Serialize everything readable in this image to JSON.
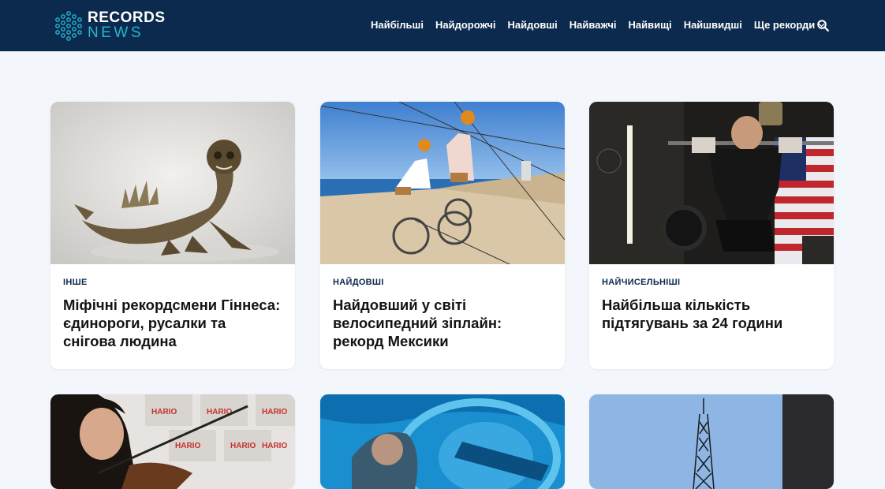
{
  "logo": {
    "top": "RECORDS",
    "bottom": "NEWS",
    "icon": "hexagon-dots-logo"
  },
  "nav": {
    "items": [
      {
        "label": "Найбільші"
      },
      {
        "label": "Найдорожчі"
      },
      {
        "label": "Найдовші"
      },
      {
        "label": "Найважчі"
      },
      {
        "label": "Найвищі"
      },
      {
        "label": "Найшвидші"
      },
      {
        "label": "Ще рекорди"
      }
    ],
    "more_icon": "chevron-down-icon",
    "search_icon": "search-icon"
  },
  "colors": {
    "header_bg": "#0c2a4d",
    "accent": "#22b7d3",
    "page_bg": "#f3f7fb"
  },
  "cards": [
    {
      "category": "Інше",
      "title": "Міфічні рекордсмени Гіннеса: єдинороги, русалки та снігова людина",
      "image": "mummified-mermaid-figure"
    },
    {
      "category": "Найдовші",
      "title": "Найдовший у світі велосипедний зіплайн: рекорд Мексики",
      "image": "zipline-bicycles-over-beach"
    },
    {
      "category": "Найчисельніші",
      "title": "Найбільша кількість підтягувань за 24 години",
      "image": "man-doing-pullups-in-gym"
    },
    {
      "category": "",
      "title": "",
      "image": "woman-with-violin"
    },
    {
      "category": "",
      "title": "",
      "image": "underwater-blue-scene"
    },
    {
      "category": "",
      "title": "",
      "image": "tower-against-sky"
    }
  ]
}
